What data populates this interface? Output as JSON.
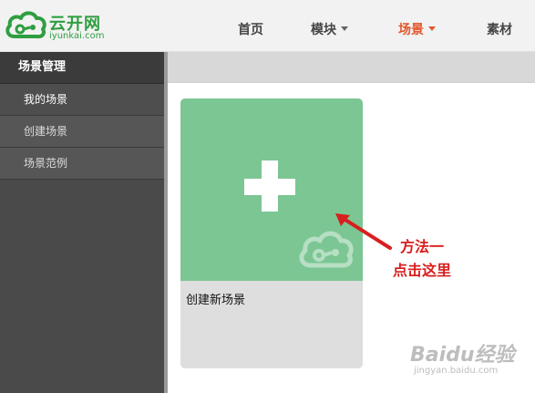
{
  "header": {
    "logo": {
      "name": "云开网",
      "domain": "iyunkai.com"
    },
    "nav": [
      {
        "label": "首页"
      },
      {
        "label": "模块"
      },
      {
        "label": "场景"
      },
      {
        "label": "素材"
      }
    ],
    "active_nav": "场景"
  },
  "sidebar": {
    "title": "场景管理",
    "items": [
      {
        "label": "我的场景"
      },
      {
        "label": "创建场景"
      },
      {
        "label": "场景范例"
      }
    ]
  },
  "main": {
    "card": {
      "label": "创建新场景",
      "icon": "plus-icon"
    }
  },
  "annotation": {
    "line1": "方法一",
    "line2": "点击这里"
  },
  "watermark": {
    "text": "Baidu经验",
    "domain": "jingyan.baidu.com"
  },
  "colors": {
    "brand": "#2f9e41",
    "active_nav": "#e3572b",
    "card_green": "#7bc693",
    "annotation": "#d81f1f",
    "sidebar_bg": "#4a4a4a"
  }
}
